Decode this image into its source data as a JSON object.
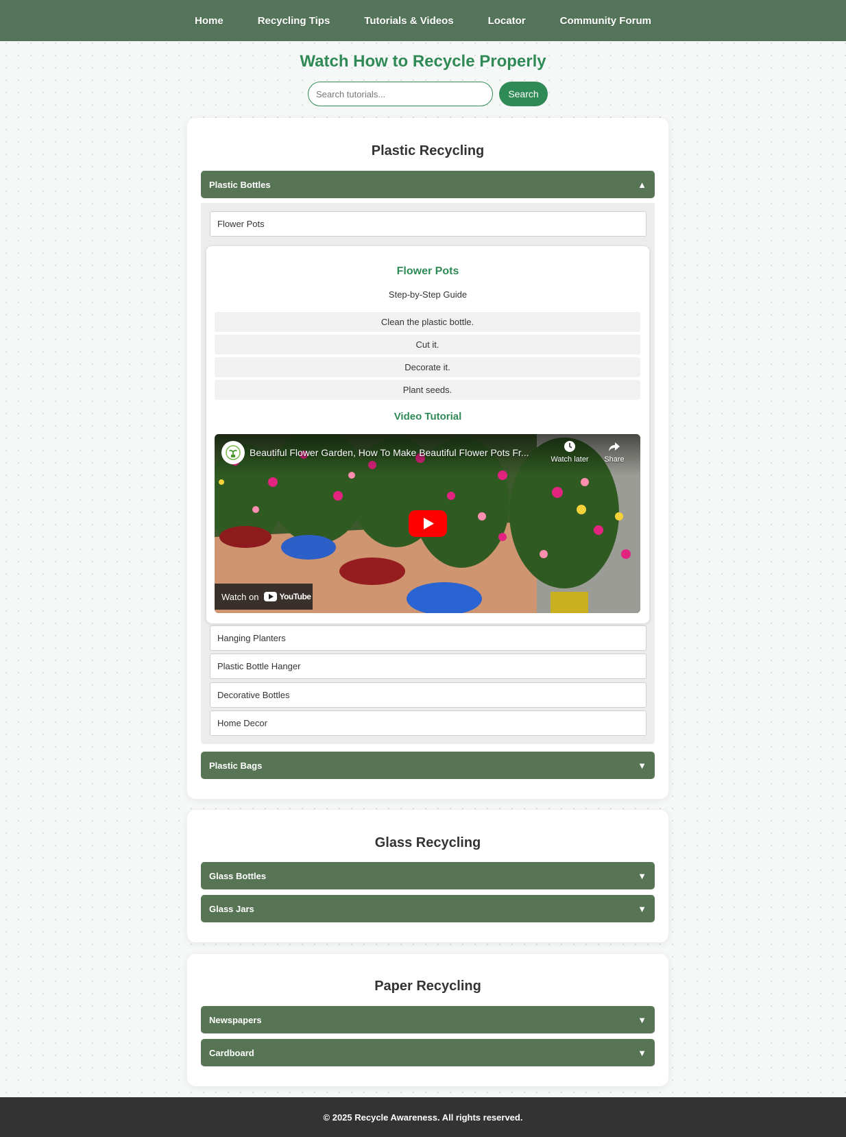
{
  "nav": {
    "items": [
      {
        "label": "Home"
      },
      {
        "label": "Recycling Tips"
      },
      {
        "label": "Tutorials & Videos"
      },
      {
        "label": "Locator"
      },
      {
        "label": "Community Forum"
      }
    ]
  },
  "page": {
    "title": "Watch How to Recycle Properly",
    "search": {
      "placeholder": "Search tutorials...",
      "value": "",
      "button_label": "Search"
    }
  },
  "sections": [
    {
      "title": "Plastic Recycling",
      "categories": [
        {
          "label": "Plastic Bottles",
          "arrow": "▲",
          "expanded": true,
          "items": [
            {
              "label": "Flower Pots"
            },
            {
              "label": "Hanging Planters"
            },
            {
              "label": "Plastic Bottle Hanger"
            },
            {
              "label": "Decorative Bottles"
            },
            {
              "label": "Home Decor"
            }
          ],
          "detail": {
            "title": "Flower Pots",
            "subtitle": "Step-by-Step Guide",
            "steps": [
              "Clean the plastic bottle.",
              "Cut it.",
              "Decorate it.",
              "Plant seeds."
            ],
            "video_heading": "Video Tutorial",
            "video": {
              "title": "Beautiful Flower Garden, How To Make Beautiful Flower Pots Fr...",
              "watch_later": "Watch later",
              "share": "Share",
              "watch_on": "Watch on",
              "brand": "YouTube"
            }
          }
        },
        {
          "label": "Plastic Bags",
          "arrow": "▼",
          "expanded": false
        }
      ]
    },
    {
      "title": "Glass Recycling",
      "categories": [
        {
          "label": "Glass Bottles",
          "arrow": "▼",
          "expanded": false
        },
        {
          "label": "Glass Jars",
          "arrow": "▼",
          "expanded": false
        }
      ]
    },
    {
      "title": "Paper Recycling",
      "categories": [
        {
          "label": "Newspapers",
          "arrow": "▼",
          "expanded": false
        },
        {
          "label": "Cardboard",
          "arrow": "▼",
          "expanded": false
        }
      ]
    }
  ],
  "footer": {
    "text": "© 2025 Recycle Awareness. All rights reserved."
  },
  "colors": {
    "nav": "#54755a",
    "accent": "#2f8a55",
    "accordion": "#577455",
    "footer": "#333333"
  }
}
